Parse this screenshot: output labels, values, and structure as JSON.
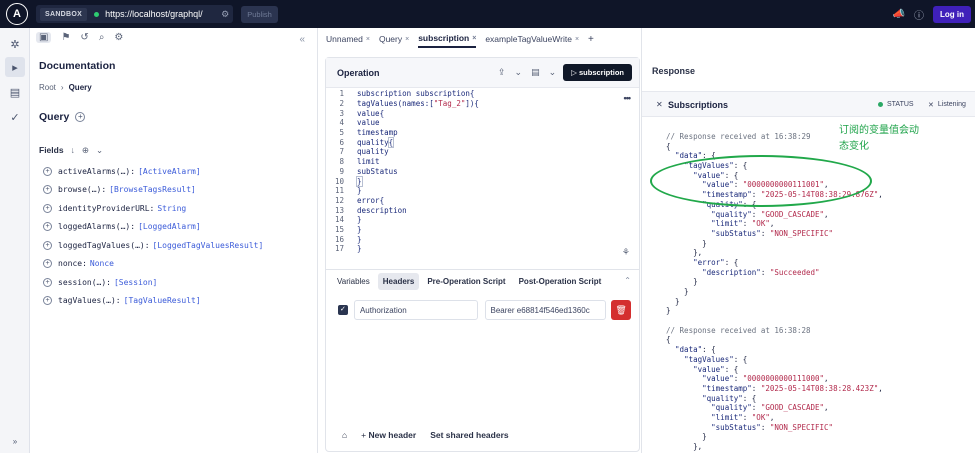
{
  "topbar": {
    "logo": "A",
    "sandbox_label": "SANDBOX",
    "url": "https://localhost/graphql/",
    "publish_label": "Publish",
    "login_label": "Log in"
  },
  "docs": {
    "title": "Documentation",
    "breadcrumb_root": "Root",
    "breadcrumb_current": "Query",
    "query_title": "Query",
    "fields_label": "Fields",
    "fields": [
      {
        "name": "activeAlarms(…):",
        "type": "[ActiveAlarm]"
      },
      {
        "name": "browse(…):",
        "type": "[BrowseTagsResult]"
      },
      {
        "name": "identityProviderURL:",
        "type": "String"
      },
      {
        "name": "loggedAlarms(…):",
        "type": "[LoggedAlarm]"
      },
      {
        "name": "loggedTagValues(…):",
        "type": "[LoggedTagValuesResult]"
      },
      {
        "name": "nonce:",
        "type": "Nonce"
      },
      {
        "name": "session(…):",
        "type": "[Session]"
      },
      {
        "name": "tagValues(…):",
        "type": "[TagValueResult]"
      }
    ]
  },
  "tabs": [
    {
      "label": "Unnamed",
      "close": "×"
    },
    {
      "label": "Query",
      "close": "×"
    },
    {
      "label": "subscription",
      "close": "×"
    },
    {
      "label": "exampleTagValueWrite",
      "close": "×"
    }
  ],
  "tab_add": "+",
  "operation": {
    "title": "Operation",
    "run_label": "subscription",
    "more": "•••",
    "lines": [
      {
        "n": "1",
        "text": "subscription subscription{"
      },
      {
        "n": "2",
        "pre": "tagValues(names:[",
        "str": "\"Tag_2\"",
        "post": "]){"
      },
      {
        "n": "3",
        "text": "value{"
      },
      {
        "n": "4",
        "text": "value"
      },
      {
        "n": "5",
        "text": "timestamp"
      },
      {
        "n": "6",
        "text": "quality{"
      },
      {
        "n": "7",
        "text": "quality"
      },
      {
        "n": "8",
        "text": "limit"
      },
      {
        "n": "9",
        "text": "subStatus"
      },
      {
        "n": "10",
        "text": "}"
      },
      {
        "n": "11",
        "text": "}"
      },
      {
        "n": "12",
        "text": "error{"
      },
      {
        "n": "13",
        "text": "description"
      },
      {
        "n": "14",
        "text": "}"
      },
      {
        "n": "15",
        "text": "}"
      },
      {
        "n": "16",
        "text": "}"
      },
      {
        "n": "17",
        "text": "}"
      }
    ]
  },
  "variables": {
    "tabs": [
      "Variables",
      "Headers",
      "Pre-Operation Script",
      "Post-Operation Script"
    ],
    "header_key": "Authorization",
    "header_value": "Bearer e68814f546ed1360c",
    "new_header": "New header",
    "set_shared": "Set shared headers"
  },
  "response": {
    "title": "Response",
    "subs_title": "Subscriptions",
    "status_label": "STATUS",
    "listening_label": "Listening",
    "annotation_line1": "订阅的变量值会动",
    "annotation_line2": "态变化",
    "lines": [
      {
        "t": "c",
        "text": "// Response received at 16:38:29"
      },
      {
        "t": "p",
        "text": "{"
      },
      {
        "t": "k",
        "ind": "  ",
        "key": "\"data\"",
        "rest": ": {"
      },
      {
        "t": "k",
        "ind": "    ",
        "key": "\"tagValues\"",
        "rest": ": {"
      },
      {
        "t": "k",
        "ind": "      ",
        "key": "\"value\"",
        "rest": ": {"
      },
      {
        "t": "kv",
        "ind": "        ",
        "key": "\"value\"",
        "val": "\"0000000000111001\"",
        "rest": ","
      },
      {
        "t": "kv",
        "ind": "        ",
        "key": "\"timestamp\"",
        "val": "\"2025-05-14T08:38:29.876Z\"",
        "rest": ","
      },
      {
        "t": "k",
        "ind": "        ",
        "key": "\"quality\"",
        "rest": ": {"
      },
      {
        "t": "kv",
        "ind": "          ",
        "key": "\"quality\"",
        "val": "\"GOOD_CASCADE\"",
        "rest": ","
      },
      {
        "t": "kv",
        "ind": "          ",
        "key": "\"limit\"",
        "val": "\"OK\"",
        "rest": ","
      },
      {
        "t": "kv",
        "ind": "          ",
        "key": "\"subStatus\"",
        "val": "\"NON_SPECIFIC\"",
        "rest": ""
      },
      {
        "t": "p",
        "text": "        }"
      },
      {
        "t": "p",
        "text": "      },"
      },
      {
        "t": "k",
        "ind": "      ",
        "key": "\"error\"",
        "rest": ": {"
      },
      {
        "t": "kv",
        "ind": "        ",
        "key": "\"description\"",
        "val": "\"Succeeded\"",
        "rest": ""
      },
      {
        "t": "p",
        "text": "      }"
      },
      {
        "t": "p",
        "text": "    }"
      },
      {
        "t": "p",
        "text": "  }"
      },
      {
        "t": "p",
        "text": "}"
      },
      {
        "t": "p",
        "text": ""
      },
      {
        "t": "c",
        "text": "// Response received at 16:38:28"
      },
      {
        "t": "p",
        "text": "{"
      },
      {
        "t": "k",
        "ind": "  ",
        "key": "\"data\"",
        "rest": ": {"
      },
      {
        "t": "k",
        "ind": "    ",
        "key": "\"tagValues\"",
        "rest": ": {"
      },
      {
        "t": "k",
        "ind": "      ",
        "key": "\"value\"",
        "rest": ": {"
      },
      {
        "t": "kv",
        "ind": "        ",
        "key": "\"value\"",
        "val": "\"0000000000111000\"",
        "rest": ","
      },
      {
        "t": "kv",
        "ind": "        ",
        "key": "\"timestamp\"",
        "val": "\"2025-05-14T08:38:28.423Z\"",
        "rest": ","
      },
      {
        "t": "k",
        "ind": "        ",
        "key": "\"quality\"",
        "rest": ": {"
      },
      {
        "t": "kv",
        "ind": "          ",
        "key": "\"quality\"",
        "val": "\"GOOD_CASCADE\"",
        "rest": ","
      },
      {
        "t": "kv",
        "ind": "          ",
        "key": "\"limit\"",
        "val": "\"OK\"",
        "rest": ","
      },
      {
        "t": "kv",
        "ind": "          ",
        "key": "\"subStatus\"",
        "val": "\"NON_SPECIFIC\"",
        "rest": ""
      },
      {
        "t": "p",
        "text": "        }"
      },
      {
        "t": "p",
        "text": "      },"
      }
    ]
  },
  "colors": {
    "topbar_bg": "#0f1528",
    "login_accent": "#3f20ba",
    "delete_red": "#d42f2f",
    "annotation_green": "#21a84a"
  }
}
